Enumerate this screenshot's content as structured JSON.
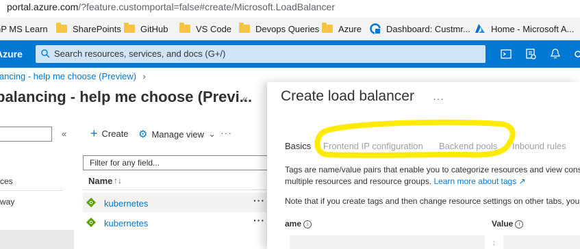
{
  "browser": {
    "url_host": "portal.azure.com",
    "url_path": "/?feature.customportal=false#create/Microsoft.LoadBalancer",
    "bookmarks": [
      {
        "label": "nP MS Learn",
        "icon": "folder-icon"
      },
      {
        "label": "SharePoints",
        "icon": "folder-icon"
      },
      {
        "label": "GitHub",
        "icon": "folder-icon"
      },
      {
        "label": "VS Code",
        "icon": "folder-icon"
      },
      {
        "label": "Devops Queries",
        "icon": "folder-icon"
      },
      {
        "label": "Azure",
        "icon": "folder-icon"
      },
      {
        "label": "Dashboard: Custmr...",
        "icon": "dashboard-icon"
      },
      {
        "label": "Home - Microsoft A...",
        "icon": "azure-logo-icon"
      }
    ]
  },
  "topbar": {
    "brand": "Azure",
    "search_placeholder": "Search resources, services, and docs (G+/)",
    "icons": [
      "cloud-shell-icon",
      "directory-filter-icon",
      "notifications-icon",
      "settings-icon"
    ]
  },
  "breadcrumb": "lancing - help me choose (Preview)",
  "left_blade": {
    "title": "balancing - help me choose (Previ...",
    "services_label": "ces",
    "gateway_label": "way"
  },
  "list": {
    "create_label": "Create",
    "manage_view_label": "Manage view",
    "filter_placeholder": "Filter for any field...",
    "column_name": "Name",
    "rows": [
      {
        "name": "kubernetes"
      },
      {
        "name": "kubernetes"
      }
    ]
  },
  "panel": {
    "title": "Create load balancer",
    "tabs": [
      "Basics",
      "Frontend IP configuration",
      "Backend pools",
      "Inbound rules"
    ],
    "desc_line1": "Tags are name/value pairs that enable you to categorize resources and view consolic",
    "desc_line2": "multiple resources and resource groups.",
    "learn_more": "Learn more about tags",
    "note": "Note that if you create tags and then change resource settings on other tabs, your t",
    "col_name": "ame",
    "col_value": "Value"
  },
  "colors": {
    "azure_blue": "#0078d4",
    "highlight": "#ffeb00"
  }
}
